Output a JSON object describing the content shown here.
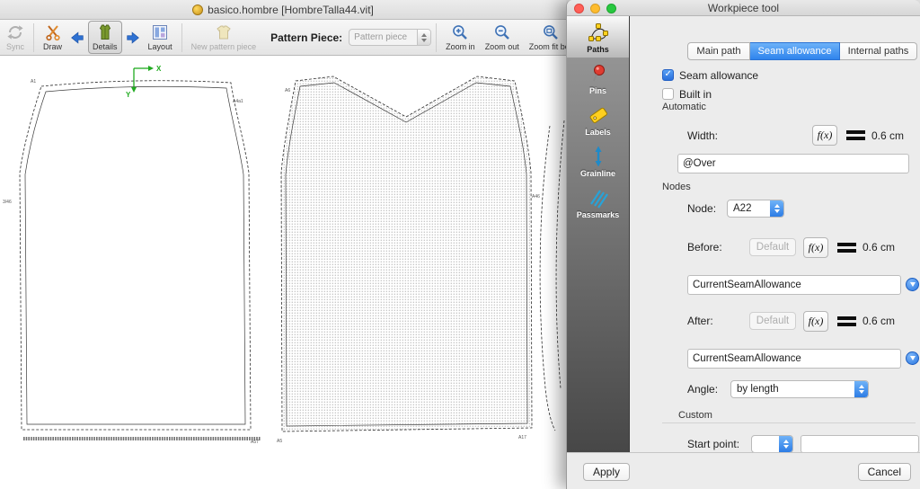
{
  "main_window": {
    "title": "basico.hombre [HombreTalla44.vit]",
    "toolbar": {
      "sync_label": "Sync",
      "draw_label": "Draw",
      "details_label": "Details",
      "layout_label": "Layout",
      "new_pattern_piece_label": "New pattern piece",
      "pattern_piece_label": "Pattern Piece:",
      "pattern_piece_value": "Pattern piece",
      "zoom_in_label": "Zoom in",
      "zoom_out_label": "Zoom out",
      "zoom_fit_label": "Zoom fit bes"
    },
    "canvas": {
      "axis_x": "X",
      "axis_y": "Y",
      "point_labels": [
        "A1",
        "A4a1",
        "3/46",
        "A57",
        "A6",
        "A46",
        "A5",
        "A17"
      ]
    }
  },
  "dialog": {
    "title": "Workpiece tool",
    "sidebar": [
      {
        "label": "Paths"
      },
      {
        "label": "Pins"
      },
      {
        "label": "Labels"
      },
      {
        "label": "Grainline"
      },
      {
        "label": "Passmarks"
      }
    ],
    "tabs": [
      {
        "label": "Main path"
      },
      {
        "label": "Seam allowance"
      },
      {
        "label": "Internal paths"
      }
    ],
    "active_tab": "Seam allowance",
    "seam_allowance": {
      "checkbox_label": "Seam allowance",
      "built_in_label": "Built in",
      "automatic_group": "Automatic",
      "width_label": "Width:",
      "fx_label": "f(x)",
      "width_value": "0.6 cm",
      "width_formula": "@Over",
      "nodes_group": "Nodes",
      "node_label": "Node:",
      "node_value": "A22",
      "before_label": "Before:",
      "before_default_label": "Default",
      "before_value": "0.6 cm",
      "before_formula": "CurrentSeamAllowance",
      "after_label": "After:",
      "after_default_label": "Default",
      "after_value": "0.6 cm",
      "after_formula": "CurrentSeamAllowance",
      "angle_label": "Angle:",
      "angle_value": "by length",
      "custom_group": "Custom",
      "start_point_label": "Start point:"
    },
    "footer": {
      "apply_label": "Apply",
      "cancel_label": "Cancel"
    },
    "colors": {
      "accent_blue": "#2f84ed",
      "stepper_blue": "#2d7ce5",
      "sidebar_dark": "#474747"
    }
  }
}
